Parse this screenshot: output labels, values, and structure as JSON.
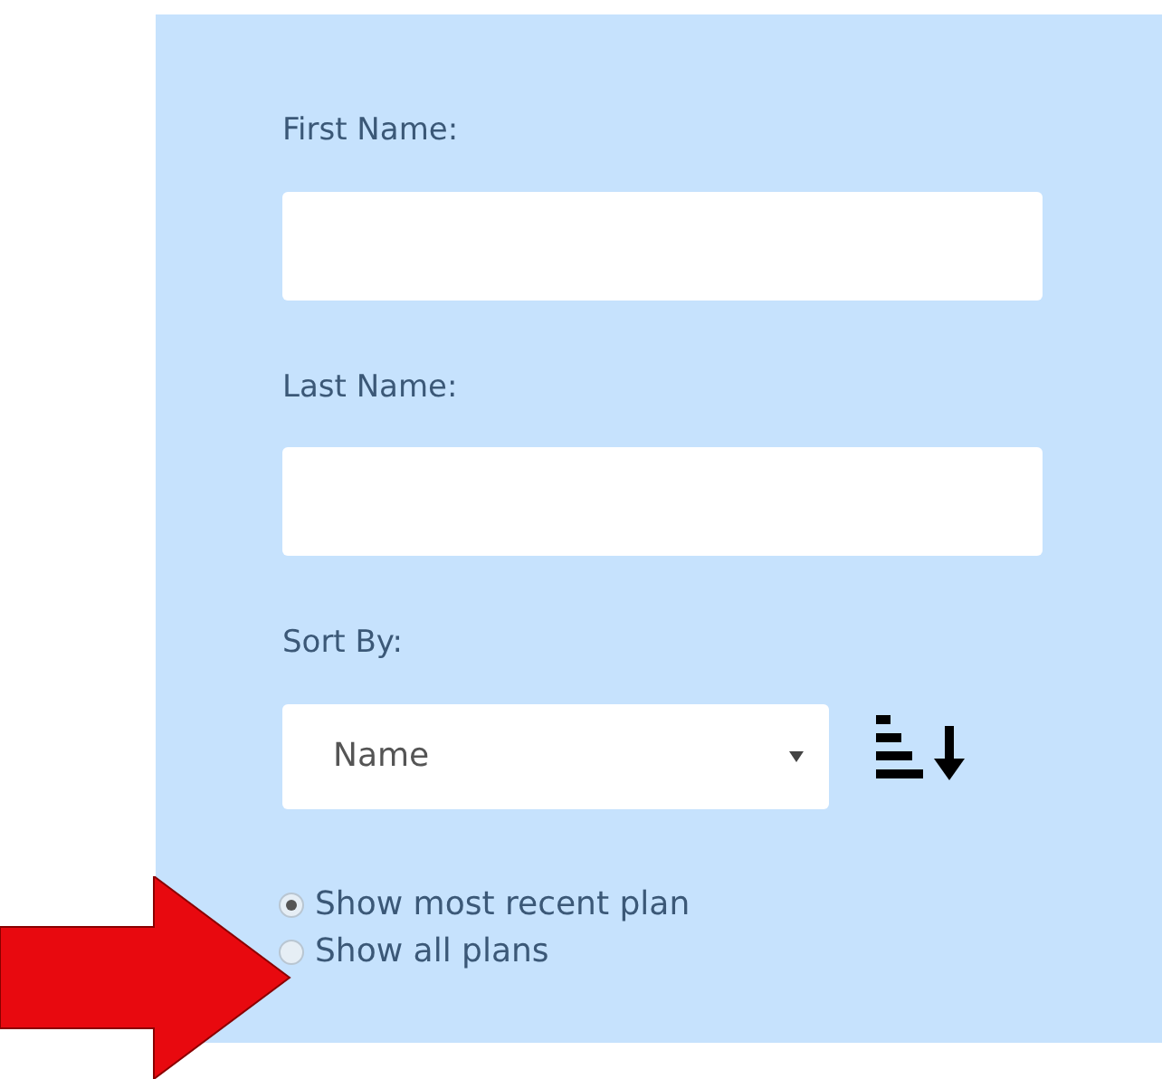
{
  "fields": [
    {
      "label": "First Name:"
    },
    {
      "label": "Last Name:"
    }
  ],
  "sort": {
    "label": "Sort By:",
    "value": "Name",
    "descending": true
  },
  "options": [
    {
      "label": "Show most recent plan",
      "selected": true
    },
    {
      "label": "Show all plans",
      "selected": false
    }
  ]
}
